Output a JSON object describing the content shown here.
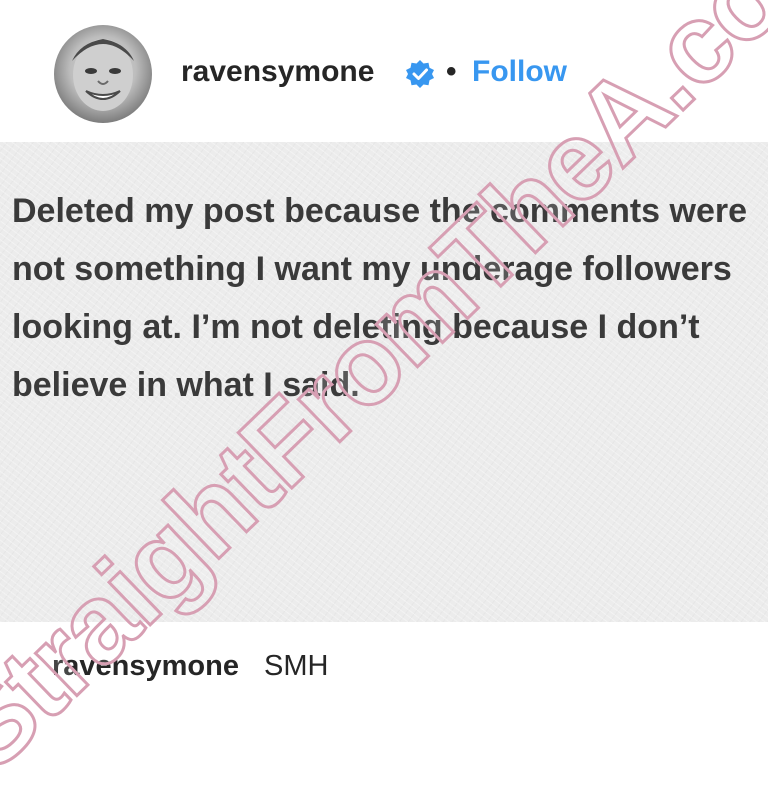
{
  "header": {
    "username": "ravensymone",
    "separator": "•",
    "follow_label": "Follow",
    "verified_icon": "verified-badge-icon",
    "accent_color": "#3897f0"
  },
  "post": {
    "text": "Deleted my post because the comments were not something I want my underage followers looking at. I’m not deleting because I don’t believe in what I said."
  },
  "caption": {
    "username": "ravensymone",
    "text": "SMH"
  },
  "watermark": {
    "text": "StraightFromTheA.com",
    "color": "#d79fb3"
  }
}
